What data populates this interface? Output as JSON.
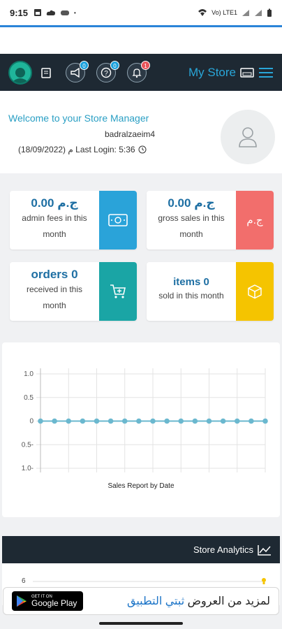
{
  "status_bar": {
    "time": "9:15",
    "network_label": "Vo) LTE1"
  },
  "nav": {
    "badges": {
      "announcements": "0",
      "help": "0",
      "notifications": "1"
    },
    "store_label": "My Store"
  },
  "welcome": {
    "title": "Welcome to your Store Manager",
    "username": "badralzaeim4",
    "last_login": "(18/09/2022) م Last Login: 5:36"
  },
  "stats": {
    "admin_fees": {
      "value": "0.00 ج.م",
      "desc_line1": "admin fees in this",
      "desc_line2": "month",
      "icon": "money-icon",
      "color": "#2aa3d9"
    },
    "gross_sales": {
      "value": "0.00 ج.م",
      "desc_line1": "gross sales in this",
      "desc_line2": "month",
      "side_text": "ج.م",
      "color": "#f26e6c"
    },
    "orders": {
      "value": "orders 0",
      "desc_line1": "received in this",
      "desc_line2": "month",
      "icon": "cart-plus-icon",
      "color": "#1aa5a5"
    },
    "items": {
      "value": "items 0",
      "desc_line1": "sold in this month",
      "icon": "cube-icon",
      "color": "#f5c400"
    }
  },
  "chart_data": {
    "type": "line",
    "title": "Sales Report by Date",
    "ylim": [
      -1.0,
      1.0
    ],
    "yticks": [
      "1.0",
      "0.5",
      "0",
      "0.5-",
      "1.0-"
    ],
    "series": [
      {
        "values": [
          0,
          0,
          0,
          0,
          0,
          0,
          0,
          0,
          0,
          0,
          0,
          0,
          0,
          0,
          0,
          0,
          0
        ],
        "color": "#6bb8cf"
      }
    ],
    "grid": true
  },
  "analytics": {
    "label": "Store Analytics",
    "axis_start": "6"
  },
  "ad": {
    "get_it_on": "GET IT ON",
    "google_play": "Google Play",
    "text_normal": "لمزيد من العروض ",
    "text_highlight": "ثبتي التطبيق"
  }
}
